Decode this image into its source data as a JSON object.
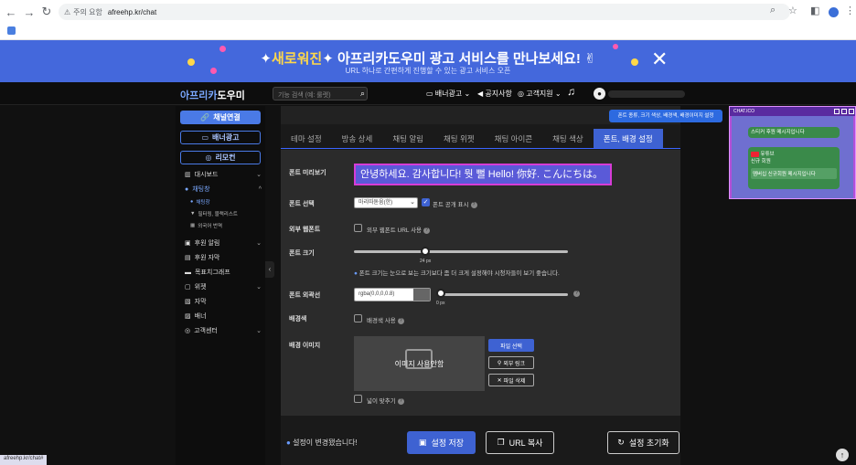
{
  "browser": {
    "warning_text": "주의 요함",
    "url": "afreehp.kr/chat"
  },
  "banner": {
    "title_highlight": "새로워진",
    "title_main": "아프리카도우미 광고 서비스를 만나보세요!",
    "subtitle": "URL 하나로 간편하게 진행할 수 있는 광고 서비스 오픈",
    "close_label": "✕"
  },
  "header": {
    "logo_a": "아프리카",
    "logo_b": "도우미",
    "search_placeholder": "기능 검색 (예: 룰렛)",
    "nav": [
      "배너광고 ⌄",
      "공지사항",
      "고객지원 ⌄"
    ]
  },
  "sidebar": {
    "buttons": [
      "채널연결",
      "배너광고",
      "리모컨"
    ],
    "items": [
      {
        "label": "대시보드",
        "chev": "⌄"
      },
      {
        "label": "채팅창",
        "chev": "^"
      },
      {
        "label": "후원 알림",
        "chev": "⌄"
      },
      {
        "label": "후원 자막",
        "chev": ""
      },
      {
        "label": "목표치그래프",
        "chev": ""
      },
      {
        "label": "위젯",
        "chev": "⌄"
      },
      {
        "label": "자막",
        "chev": ""
      },
      {
        "label": "배너",
        "chev": ""
      },
      {
        "label": "고객센터",
        "chev": "⌄"
      }
    ],
    "subitems": [
      "채팅창",
      "필터링, 블랙리스트",
      "외국어 번역"
    ]
  },
  "tooltip": "폰트 종류, 크기 색상, 배경색, 배경이미지 설정",
  "tabs": [
    "테마 설정",
    "방송 상세",
    "채팅 알림",
    "채팅 위젯",
    "채팅 아이콘",
    "채팅 색상",
    "폰트, 배경 설정"
  ],
  "form": {
    "font_preview_label": "폰트 미리보기",
    "font_preview_text": "안녕하세요. 감사합니다! 뭣 뻘 Hello! 你好. こんにちは。",
    "font_select_label": "폰트 선택",
    "font_select_value": "마리따돋움(한)",
    "font_public_label": "폰트 공개 표시",
    "webfont_label": "외부 웹폰트",
    "webfont_check_label": "외부 웹폰트 URL 사용",
    "font_size_label": "폰트 크기",
    "font_size_value": "24 px",
    "font_size_hint": "폰트 크기는 눈으로 보는 크기보다 좀 더 크게 설정해야 시청자들이 보기 좋습니다.",
    "outline_label": "폰트 외곽선",
    "outline_value": "rgba(0,0,0,0.8)",
    "outline_px": "0 px",
    "bgcolor_label": "배경색",
    "bgcolor_check_label": "배경색 사용",
    "bgimage_label": "배경 이미지",
    "bgimage_placeholder": "이미지 사용안함",
    "file_select": "파일 선택",
    "external_link": "외부 링크",
    "file_delete": "파일 삭제",
    "fit_width_label": "넓이 맞추기"
  },
  "footer": {
    "status": "설정이 변경됐습니다!",
    "save": "설정 저장",
    "copy_url": "URL 복사",
    "reset": "설정 초기화"
  },
  "overlay": {
    "bar_title": "CHAT.ICO",
    "msg1": "스티커 후원 메시지입니다",
    "msg2_name": "유튜브",
    "msg2_sub": "신규 회원",
    "msg2_body": "멤버십 신규회원 메시지입니다"
  },
  "statusbar": "afreehp.kr/chat#",
  "colors": {
    "accent": "#3e62d2",
    "banner": "#4468dc",
    "preview_border": "#d63cd6"
  }
}
